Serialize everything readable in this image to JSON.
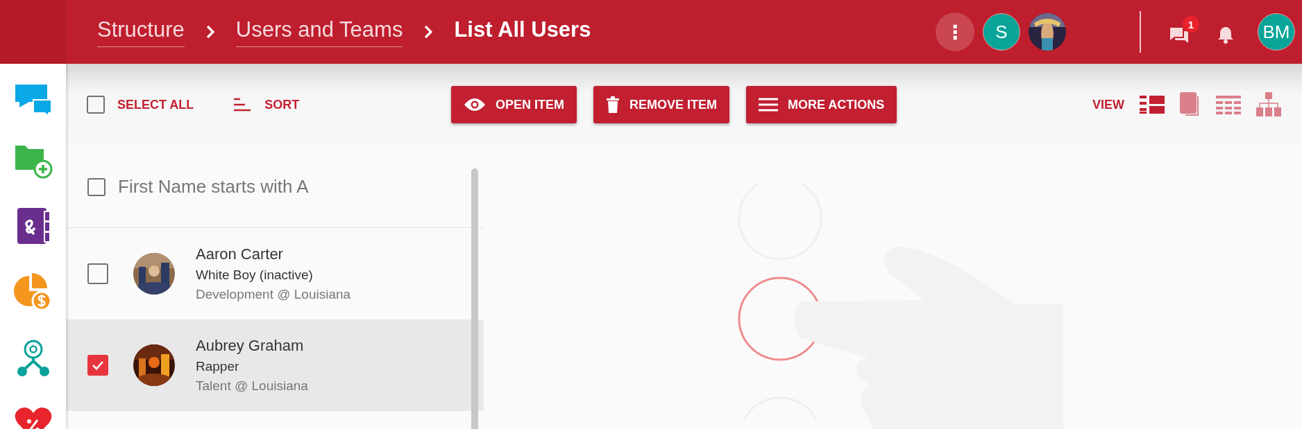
{
  "breadcrumbs": [
    {
      "label": "Structure",
      "current": false
    },
    {
      "label": "Users and Teams",
      "current": false
    },
    {
      "label": "List All Users",
      "current": true
    }
  ],
  "header": {
    "more_label": "⋮",
    "avatars": [
      {
        "kind": "initials",
        "initials": "S"
      },
      {
        "kind": "picture"
      }
    ],
    "messages_badge": "1",
    "user_initials": "BM"
  },
  "toolbar": {
    "select_all": {
      "label": "SELECT ALL",
      "checked": false
    },
    "sort_label": "SORT",
    "actions": [
      {
        "kind": "eye",
        "label": "OPEN ITEM"
      },
      {
        "kind": "trash",
        "label": "REMOVE ITEM"
      },
      {
        "kind": "menu",
        "label": "MORE ACTIONS"
      }
    ],
    "view_label": "VIEW",
    "view_options": [
      {
        "kind": "list",
        "selected": true
      },
      {
        "kind": "cards",
        "selected": false
      },
      {
        "kind": "table",
        "selected": false
      },
      {
        "kind": "tree",
        "selected": false
      }
    ]
  },
  "list": {
    "group": {
      "label": "First Name starts with A",
      "checked": false
    },
    "users": [
      {
        "name": "Aaron Carter",
        "title": "White Boy (inactive)",
        "department": "Development @ Louisiana",
        "checked": false,
        "selected": false
      },
      {
        "name": "Aubrey Graham",
        "title": "Rapper",
        "department": "Talent @ Louisiana",
        "checked": true,
        "selected": true
      }
    ]
  }
}
